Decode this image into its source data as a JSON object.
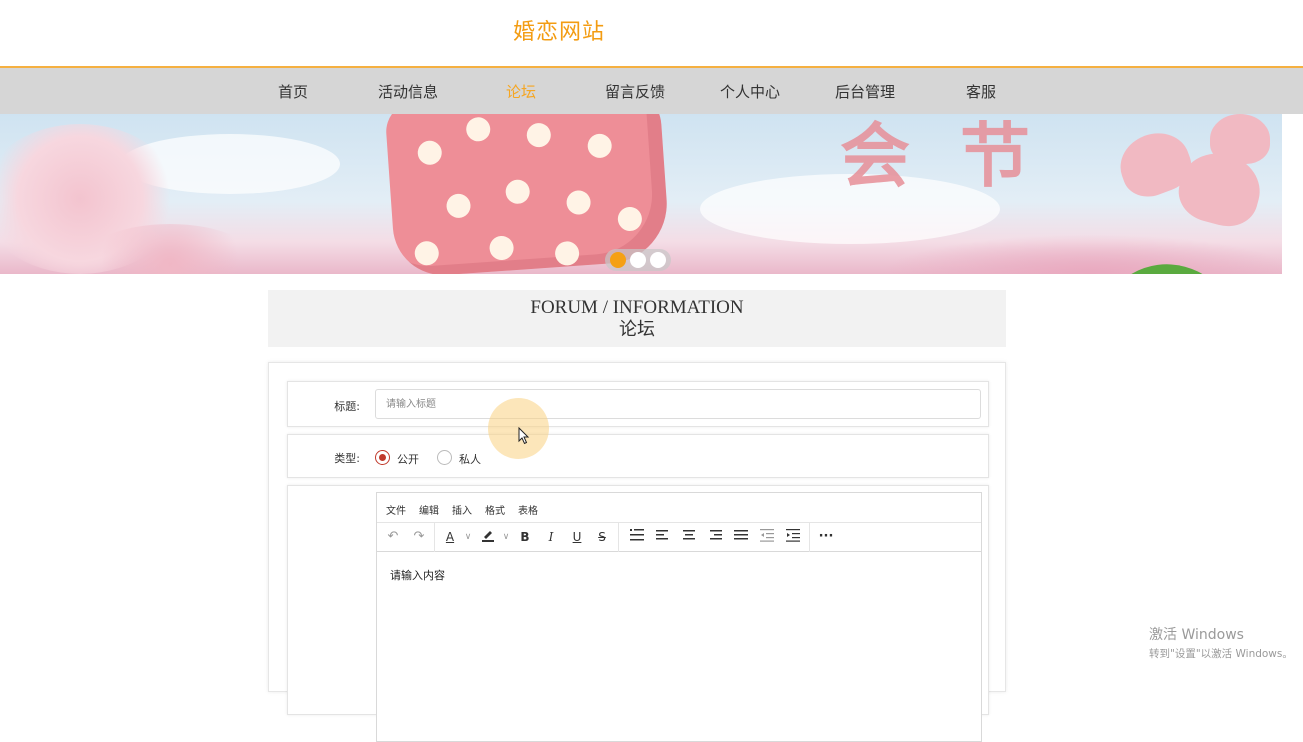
{
  "site": {
    "title": "婚恋网站"
  },
  "nav": {
    "items": [
      {
        "label": "首页"
      },
      {
        "label": "活动信息"
      },
      {
        "label": "论坛",
        "active": true
      },
      {
        "label": "留言反馈"
      },
      {
        "label": "个人中心"
      },
      {
        "label": "后台管理"
      },
      {
        "label": "客服"
      }
    ],
    "active_color": "#f5a623"
  },
  "banner": {
    "slides_count": 3,
    "active_slide": 1,
    "glyphs": [
      "会",
      "节"
    ]
  },
  "forum_header": {
    "en": "FORUM / INFORMATION",
    "cn": "论坛"
  },
  "form": {
    "title_label": "标题:",
    "title_placeholder": "请输入标题",
    "type_label": "类型:",
    "type_options": [
      {
        "label": "公开",
        "checked": true
      },
      {
        "label": "私人",
        "checked": false
      }
    ],
    "editor": {
      "menu": [
        "文件",
        "编辑",
        "插入",
        "格式",
        "表格"
      ],
      "toolbar_icons": [
        "undo-icon",
        "redo-icon",
        "text-color-icon",
        "highlight-icon",
        "bold-icon",
        "italic-icon",
        "underline-icon",
        "strikethrough-icon",
        "ordered-list-icon",
        "align-left-icon",
        "align-center-icon",
        "align-right-icon",
        "align-justify-icon",
        "outdent-icon",
        "indent-icon",
        "more-icon"
      ],
      "placeholder": "请输入内容"
    }
  },
  "watermark": {
    "title": "激活 Windows",
    "subtitle": "转到\"设置\"以激活 Windows。"
  },
  "colors": {
    "brand": "#f39c12",
    "nav_bg": "#d6d6d6",
    "radio_checked": "#c0392b",
    "slider_active": "#f5a014"
  }
}
